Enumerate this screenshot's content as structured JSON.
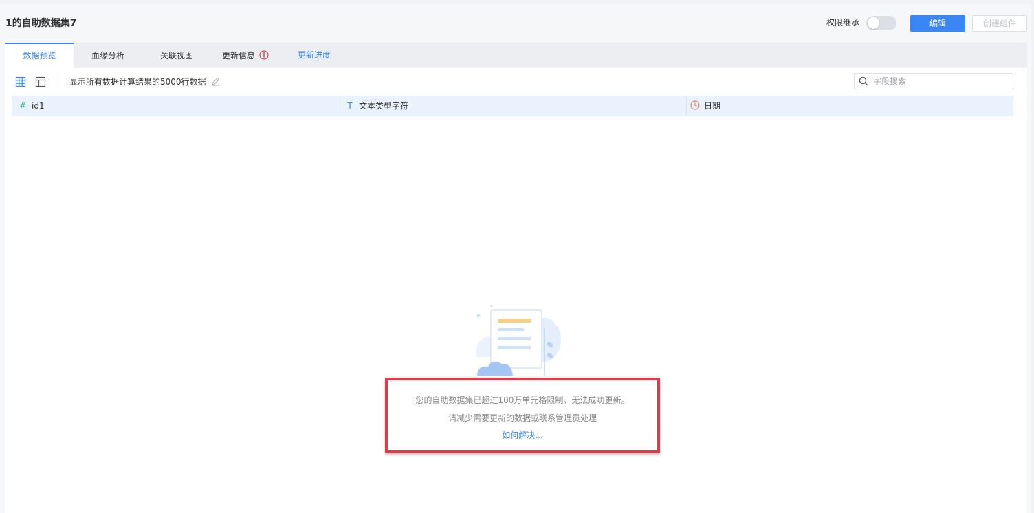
{
  "header": {
    "title": "1的自助数据集7",
    "permission_label": "权限继承",
    "edit_label": "编辑",
    "create_component_label": "创建组件"
  },
  "tabs": [
    {
      "label": "数据预览",
      "active": true
    },
    {
      "label": "血缘分析"
    },
    {
      "label": "关联视图"
    },
    {
      "label": "更新信息"
    },
    {
      "label": "更新进度"
    }
  ],
  "toolbar": {
    "row_info": "显示所有数据计算结果的5000行数据",
    "search_placeholder": "字段搜索"
  },
  "table": {
    "columns": [
      {
        "type_icon": "#",
        "name": "id1"
      },
      {
        "type_icon": "T",
        "name": "文本类型字符"
      },
      {
        "type_icon": "clock-icon",
        "name": "日期"
      }
    ]
  },
  "empty_state": {
    "message_line1": "您的自助数据集已超过100万单元格限制，无法成功更新。",
    "message_line2": "请减少需要更新的数据或联系管理员处理",
    "help_link": "如何解决..."
  },
  "colors": {
    "primary": "#3a86f4",
    "highlight_border": "#e53946",
    "error_icon": "#e53946",
    "date_icon": "#f0835a",
    "number_icon": "#3ab795"
  }
}
